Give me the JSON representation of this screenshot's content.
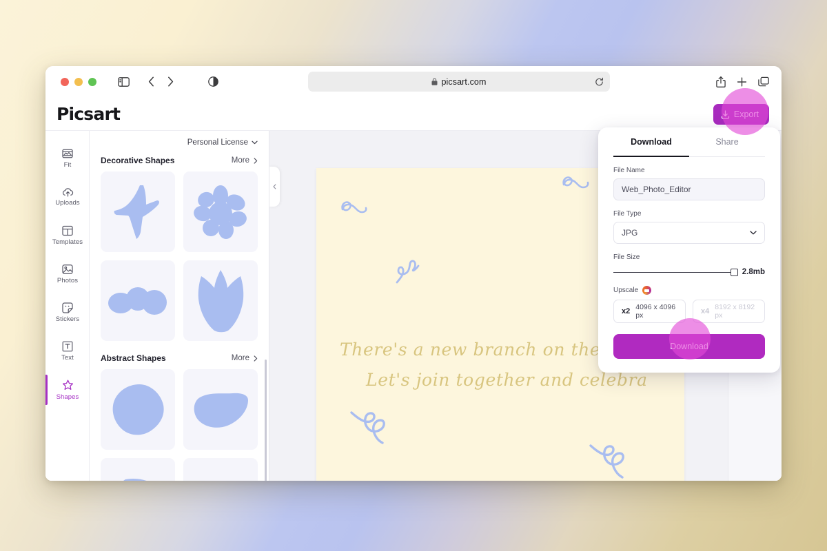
{
  "browser": {
    "url": "picsart.com",
    "lock_icon": "lock-icon",
    "reload_icon": "reload-icon",
    "back_icon": "chevron-left-icon",
    "forward_icon": "chevron-right-icon",
    "sidebar_icon": "sidebar-toggle-icon",
    "reader_icon": "reader-mode-icon",
    "share_icon": "share-icon",
    "newtab_icon": "plus-icon",
    "tabs_icon": "tab-overview-icon"
  },
  "app": {
    "logo": "Picsart",
    "rail": [
      {
        "label": "Fit",
        "icon": "fit-icon",
        "active": false
      },
      {
        "label": "Uploads",
        "icon": "upload-cloud-icon",
        "active": false
      },
      {
        "label": "Templates",
        "icon": "templates-icon",
        "active": false
      },
      {
        "label": "Photos",
        "icon": "photo-icon",
        "active": false
      },
      {
        "label": "Stickers",
        "icon": "sticker-icon",
        "active": false
      },
      {
        "label": "Text",
        "icon": "text-icon",
        "active": false
      },
      {
        "label": "Shapes",
        "icon": "star-icon",
        "active": true
      }
    ],
    "license": "Personal License",
    "license_chevron": "chevron-down-icon",
    "sections": [
      {
        "title": "Decorative Shapes",
        "more": "More",
        "shapes": [
          "bird",
          "flower",
          "blob-trio",
          "tulip"
        ]
      },
      {
        "title": "Abstract Shapes",
        "more": "More",
        "shapes": [
          "blob-round",
          "blob-wave",
          "blob-cut-a",
          "blob-cut-b"
        ]
      }
    ],
    "export_button": "Export",
    "export_icon": "download-icon",
    "collapse_icon": "chevron-left-icon"
  },
  "canvas": {
    "text_line1": "There's a new branch on the famil",
    "text_line2": "Let's join together and celebra",
    "background_color": "#fdf6dd",
    "text_color": "#d8c57f",
    "squiggle_color": "#a9bdf0"
  },
  "download_panel": {
    "tabs": [
      {
        "label": "Download",
        "active": true
      },
      {
        "label": "Share",
        "active": false
      }
    ],
    "file_name_label": "File Name",
    "file_name_value": "Web_Photo_Editor",
    "file_type_label": "File Type",
    "file_type_value": "JPG",
    "file_type_chevron": "chevron-down-icon",
    "file_size_label": "File Size",
    "file_size_value": "2.8mb",
    "upscale_label": "Upscale",
    "upscale_badge_icon": "premium-badge-icon",
    "upscale_options": [
      {
        "mult": "x2",
        "dims": "4096 x 4096 px",
        "enabled": true
      },
      {
        "mult": "x4",
        "dims": "8192 x 8192 px",
        "enabled": false
      }
    ],
    "download_button": "Download",
    "accent_color": "#b02ac0"
  },
  "layers": {
    "count": 4,
    "thumb_icon": "squiggle-layer-thumb"
  }
}
